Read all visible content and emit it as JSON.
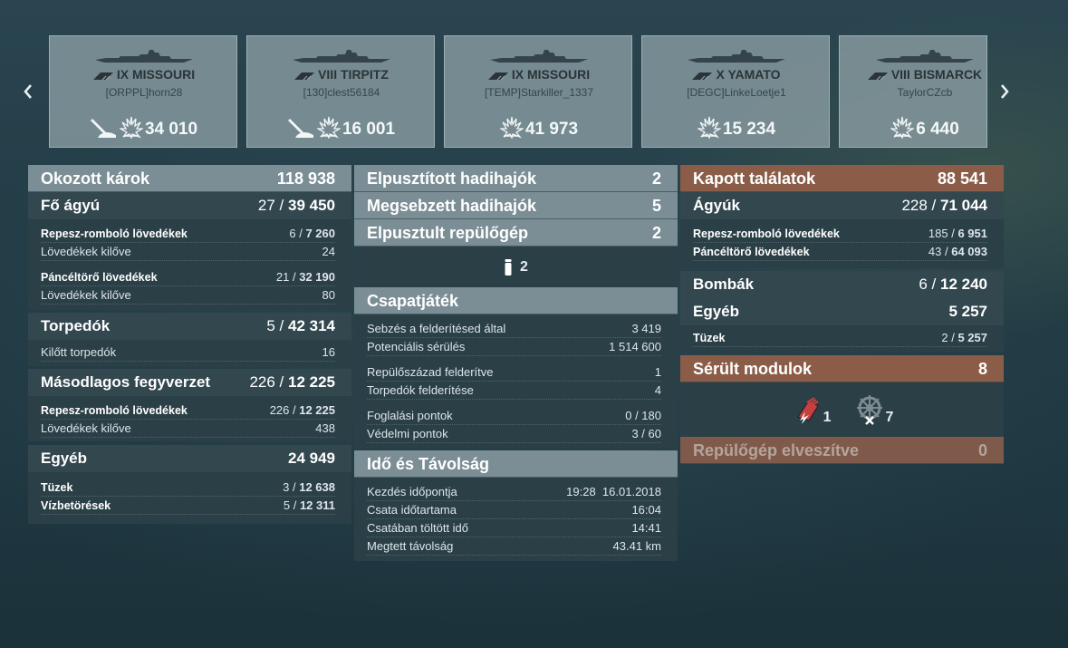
{
  "nav": {
    "prev": "‹",
    "next": "›"
  },
  "ships": [
    {
      "tier": "IX",
      "name": "MISSOURI",
      "player": "[ORPPL]horn28",
      "damage": "34 010",
      "icons": [
        "torpedo-hit-icon",
        "fire-hit-icon"
      ]
    },
    {
      "tier": "VIII",
      "name": "TIRPITZ",
      "player": "[130]clest56184",
      "damage": "16 001",
      "icons": [
        "torpedo-hit-icon",
        "fire-hit-icon"
      ]
    },
    {
      "tier": "IX",
      "name": "MISSOURI",
      "player": "[TEMP]Starkiller_1337",
      "damage": "41 973",
      "icons": [
        "fire-hit-icon"
      ]
    },
    {
      "tier": "X",
      "name": "YAMATO",
      "player": "[DEGC]LinkeLoetje1",
      "damage": "15 234",
      "icons": [
        "fire-hit-icon"
      ]
    },
    {
      "tier": "VIII",
      "name": "BISMARCK",
      "player": "TaylorCZcb",
      "damage": "6 440",
      "icons": [
        "fire-hit-icon"
      ]
    }
  ],
  "left": {
    "header": {
      "label": "Okozott károk",
      "value": "118 938"
    },
    "main_guns": {
      "label": "Fő ágyú",
      "hits": "27",
      "sep": " / ",
      "total": "39 450",
      "he": {
        "label": "Repesz-romboló lövedékek",
        "hits": "6",
        "sep": " / ",
        "total": "7 260"
      },
      "he_fired": {
        "label": "Lövedékek kilőve",
        "value": "24"
      },
      "ap": {
        "label": "Páncéltörő lövedékek",
        "hits": "21",
        "sep": " / ",
        "total": "32 190"
      },
      "ap_fired": {
        "label": "Lövedékek kilőve",
        "value": "80"
      }
    },
    "torpedoes": {
      "label": "Torpedók",
      "hits": "5",
      "sep": " / ",
      "total": "42 314",
      "fired": {
        "label": "Kilőtt torpedók",
        "value": "16"
      }
    },
    "secondary": {
      "label": "Másodlagos fegyverzet",
      "hits": "226",
      "sep": " / ",
      "total": "12 225",
      "he": {
        "label": "Repesz-romboló lövedékek",
        "hits": "226",
        "sep": " / ",
        "total": "12 225"
      },
      "fired": {
        "label": "Lövedékek kilőve",
        "value": "438"
      }
    },
    "other": {
      "label": "Egyéb",
      "value": "24 949",
      "fires": {
        "label": "Tüzek",
        "hits": "3",
        "sep": " / ",
        "total": "12 638"
      },
      "flooding": {
        "label": "Vízbetörések",
        "hits": "5",
        "sep": " / ",
        "total": "12 311"
      }
    }
  },
  "middle": {
    "destroyed_ships": {
      "label": "Elpusztított hadihajók",
      "value": "2"
    },
    "damaged_ships": {
      "label": "Megsebzett hadihajók",
      "value": "5"
    },
    "destroyed_aircraft": {
      "label": "Elpusztult repülőgép",
      "value": "2"
    },
    "ribbon_count": "2",
    "teamplay": {
      "label": "Csapatjáték",
      "rows": [
        {
          "label": "Sebzés a felderítésed által",
          "value": "3 419"
        },
        {
          "label": "Potenciális sérülés",
          "value": "1 514 600"
        },
        {
          "label": "Repülőszázad felderítve",
          "value": "1"
        },
        {
          "label": "Torpedók felderítése",
          "value": "4"
        },
        {
          "label": "Foglalási pontok",
          "value": "0 / 180"
        },
        {
          "label": "Védelmi pontok",
          "value": "3 / 60"
        }
      ]
    },
    "time": {
      "label": "Idő és Távolság",
      "rows": [
        {
          "label": "Kezdés időpontja",
          "value": "19:28  16.01.2018"
        },
        {
          "label": "Csata időtartama",
          "value": "16:04"
        },
        {
          "label": "Csatában töltött idő",
          "value": "14:41"
        },
        {
          "label": "Megtett távolság",
          "value": "43.41 km"
        }
      ]
    }
  },
  "right": {
    "header": {
      "label": "Kapott találatok",
      "value": "88 541"
    },
    "guns": {
      "label": "Ágyúk",
      "hits": "228",
      "sep": " / ",
      "total": "71 044",
      "he": {
        "label": "Repesz-romboló lövedékek",
        "hits": "185",
        "sep": " / ",
        "total": "6 951"
      },
      "ap": {
        "label": "Páncéltörő lövedékek",
        "hits": "43",
        "sep": " / ",
        "total": "64 093"
      }
    },
    "bombs": {
      "label": "Bombák",
      "hits": "6",
      "sep": " / ",
      "total": "12 240"
    },
    "other": {
      "label": "Egyéb",
      "value": "5 257",
      "fires": {
        "label": "Tüzek",
        "hits": "2",
        "sep": " / ",
        "total": "5 257"
      }
    },
    "modules": {
      "label": "Sérült modulok",
      "value": "8",
      "items": [
        {
          "icon": "engine-damaged-icon",
          "count": "1"
        },
        {
          "icon": "steering-damaged-icon",
          "count": "7"
        }
      ]
    },
    "aircraft_lost": {
      "label": "Repülőgép elveszítve",
      "value": "0"
    }
  }
}
